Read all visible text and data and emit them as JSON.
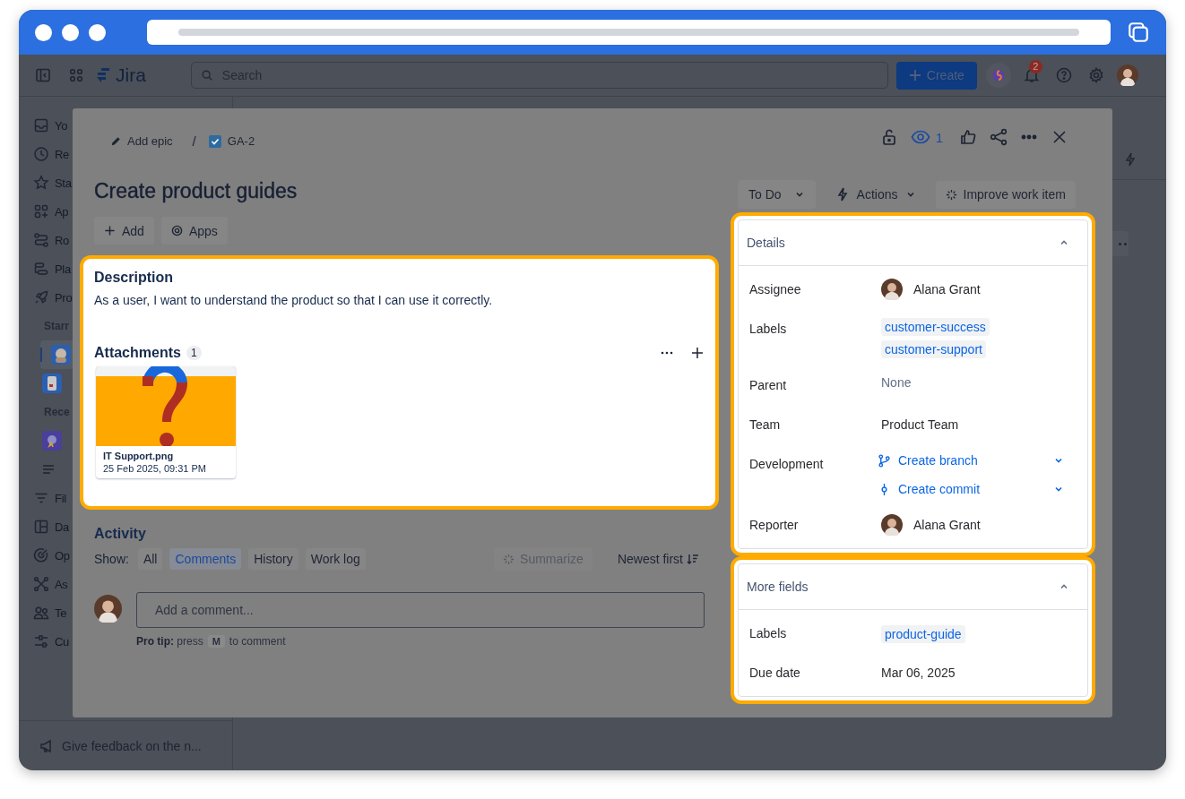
{
  "top_nav": {
    "product": "Jira",
    "search": {
      "placeholder": "Search"
    },
    "create": "Create",
    "notification_count": "2"
  },
  "sidebar": {
    "items": [
      {
        "kind": "nav",
        "label": "Yo",
        "selected": false
      },
      {
        "kind": "nav",
        "label": "Re",
        "selected": false
      },
      {
        "kind": "nav",
        "label": "Sta",
        "selected": false
      },
      {
        "kind": "nav",
        "label": "Ap",
        "selected": false
      },
      {
        "kind": "nav",
        "label": "Ro",
        "selected": false
      },
      {
        "kind": "nav",
        "label": "Pla",
        "selected": false
      },
      {
        "kind": "nav",
        "label": "Pro",
        "selected": false
      },
      {
        "kind": "heading",
        "label": "Starr"
      },
      {
        "kind": "project",
        "selected": true
      },
      {
        "kind": "project",
        "selected": false
      },
      {
        "kind": "heading",
        "label": "Rece"
      },
      {
        "kind": "project",
        "selected": false
      },
      {
        "kind": "sub",
        "selected": false
      },
      {
        "kind": "nav",
        "label": "Fil",
        "selected": false
      },
      {
        "kind": "nav",
        "label": "Da",
        "selected": false
      },
      {
        "kind": "nav",
        "label": "Op",
        "selected": false
      },
      {
        "kind": "nav",
        "label": "As",
        "selected": false
      },
      {
        "kind": "nav",
        "label": "Te",
        "selected": false
      },
      {
        "kind": "nav",
        "label": "Cu",
        "selected": false
      }
    ],
    "feedback": "Give feedback on the n..."
  },
  "issue": {
    "breadcrumb_separator": "/",
    "breadcrumb": [
      {
        "kind": "epic",
        "label": "Add epic"
      },
      {
        "kind": "key",
        "label": "GA-2"
      }
    ],
    "watchers": "1",
    "title": "Create product guides",
    "quick_actions": [
      "Add",
      "Apps"
    ],
    "status": "To Do",
    "actions_menu": "Actions",
    "improve": "Improve work item",
    "description": {
      "heading": "Description",
      "text": "As a user, I want to understand the product so that I can use it correctly.",
      "highlighted": true
    },
    "attachments": {
      "heading": "Attachments",
      "count": "1",
      "files": [
        {
          "kind": "picture",
          "name": "IT Support.png",
          "date": "25 Feb 2025, 09:31 PM"
        }
      ]
    },
    "activity": {
      "heading": "Activity",
      "show_label": "Show:",
      "filters": [
        {
          "label": "All",
          "selected": false
        },
        {
          "label": "Comments",
          "selected": true
        },
        {
          "label": "History",
          "selected": false
        },
        {
          "label": "Work log",
          "selected": false
        }
      ],
      "summarize": {
        "label": "Summarize",
        "disabled": true
      },
      "sort": "Newest first",
      "comment": {
        "placeholder": "Add a comment..."
      },
      "pro_tip": "**Pro tip:** press",
      "shortcut_key": "M",
      "pro_tip_end": "to comment"
    },
    "details": {
      "heading": "Details",
      "expanded": true,
      "highlighted": true,
      "fields": [
        {
          "kind": "person",
          "label": "Assignee",
          "value": "Alana Grant"
        },
        {
          "kind": "tags",
          "label": "Labels",
          "tags": [
            "customer-success",
            "customer-support"
          ]
        },
        {
          "kind": "empty",
          "label": "Parent",
          "value": "None"
        },
        {
          "kind": "text",
          "label": "Team",
          "value": "Product Team"
        },
        {
          "kind": "dev",
          "label": "Development",
          "links": [
            {
              "kind": "branch",
              "label": "Create branch"
            },
            {
              "kind": "commit",
              "label": "Create commit"
            }
          ]
        },
        {
          "kind": "person",
          "label": "Reporter",
          "value": "Alana Grant"
        }
      ]
    },
    "more_fields": {
      "heading": "More fields",
      "expanded": true,
      "highlighted": true,
      "fields": [
        {
          "kind": "tags",
          "label": "Labels",
          "tags": [
            "product-guide"
          ]
        },
        {
          "kind": "text",
          "label": "Due date",
          "value": "Mar 06, 2025"
        }
      ]
    }
  }
}
